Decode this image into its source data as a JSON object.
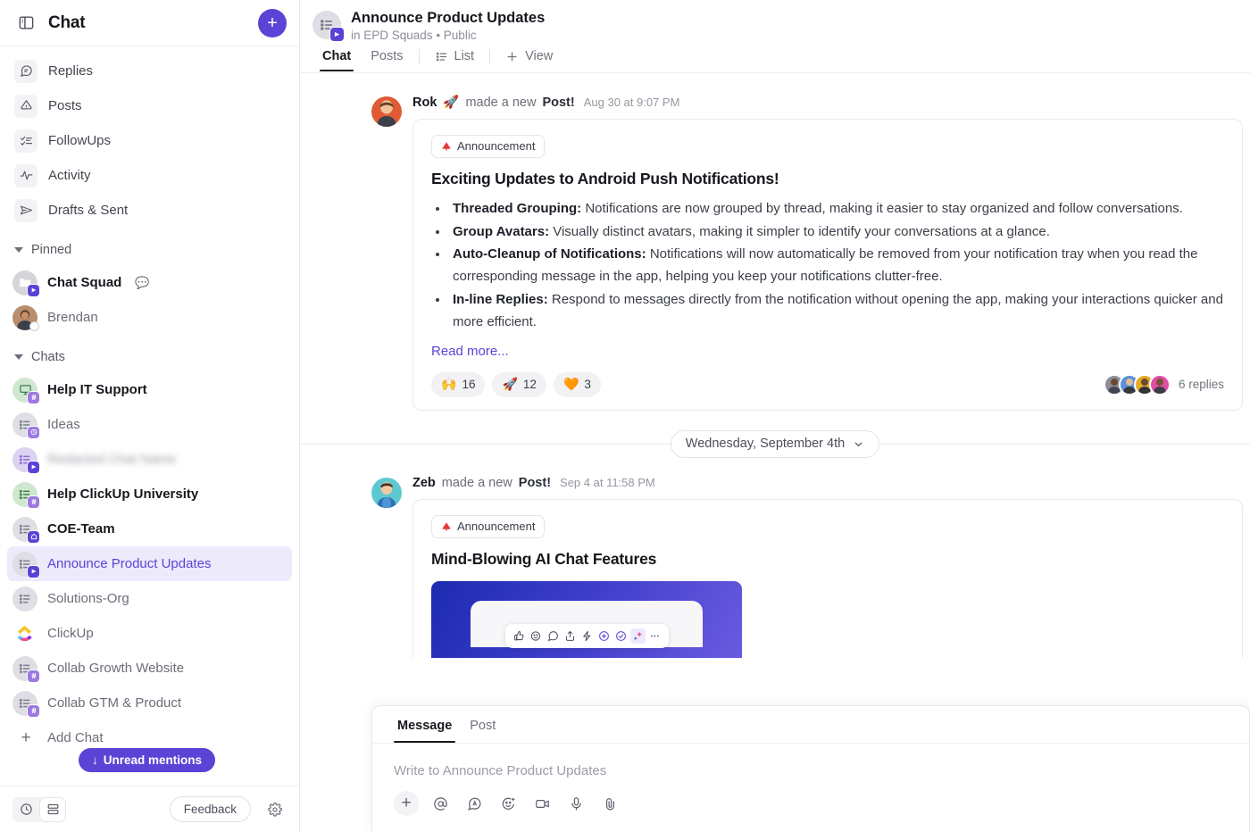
{
  "sidebar": {
    "panel_toggle_icon": "panel-toggle-icon",
    "title": "Chat",
    "new_button_label": "+",
    "nav": [
      {
        "label": "Replies",
        "icon": "comment-icon"
      },
      {
        "label": "Posts",
        "icon": "megaphone-icon"
      },
      {
        "label": "FollowUps",
        "icon": "checklist-icon"
      },
      {
        "label": "Activity",
        "icon": "activity-pulse-icon"
      },
      {
        "label": "Drafts & Sent",
        "icon": "send-plane-icon"
      }
    ],
    "sections": [
      {
        "label": "Pinned",
        "items": [
          {
            "label": "Chat Squad",
            "unread": true,
            "emoji": "💬",
            "avatar": "folder",
            "badge": "channel"
          },
          {
            "label": "Brendan",
            "unread": false,
            "avatar": "person",
            "badge": "status"
          }
        ]
      },
      {
        "label": "Chats",
        "items": [
          {
            "label": "Help IT Support",
            "unread": true,
            "avatar": "monitor-green",
            "badge": "hash"
          },
          {
            "label": "Ideas",
            "unread": false,
            "avatar": "list-gray",
            "badge": "clock"
          },
          {
            "label": "Redacted Chat Name",
            "unread": false,
            "blurred": true,
            "avatar": "list-violet",
            "badge": "channel"
          },
          {
            "label": "Help ClickUp University",
            "unread": true,
            "avatar": "list-green",
            "badge": "hash"
          },
          {
            "label": "COE-Team",
            "unread": true,
            "avatar": "list-gray",
            "badge": "home"
          },
          {
            "label": "Announce Product Updates",
            "unread": false,
            "active": true,
            "avatar": "list-gray",
            "badge": "channel"
          },
          {
            "label": "Solutions-Org",
            "unread": false,
            "avatar": "list-gray",
            "badge": "none"
          },
          {
            "label": "ClickUp",
            "unread": false,
            "avatar": "clickup-logo",
            "badge": "none"
          },
          {
            "label": "Collab Growth Website",
            "unread": false,
            "avatar": "list-gray",
            "badge": "hash"
          },
          {
            "label": "Collab GTM & Product",
            "unread": false,
            "avatar": "list-gray",
            "badge": "hash"
          }
        ]
      }
    ],
    "add_chat_label": "Add Chat",
    "unread_mentions_label": "Unread mentions",
    "unread_mentions_arrow": "↓",
    "footer": {
      "history_icon": "clock-history-icon",
      "layout_icon": "stacked-layout-icon",
      "feedback_label": "Feedback",
      "settings_icon": "gear-icon"
    }
  },
  "header": {
    "avatar_icon": "channel-list-icon",
    "title": "Announce Product Updates",
    "subtitle_prefix": "in ",
    "subtitle_space": "EPD Squads",
    "subtitle_sep": " • ",
    "subtitle_privacy": "Public",
    "tabs": [
      {
        "label": "Chat",
        "active": true
      },
      {
        "label": "Posts",
        "active": false
      },
      {
        "label": "List",
        "active": false,
        "icon": "list-icon"
      },
      {
        "label": "View",
        "active": false,
        "icon": "plus-icon"
      }
    ]
  },
  "feed": {
    "posts": [
      {
        "author": "Rok",
        "author_emoji": "🚀",
        "action": "made a new ",
        "action_bold": "Post!",
        "timestamp": "Aug 30 at 9:07 PM",
        "badge_label": "Announcement",
        "badge_icon": "megaphone-red-icon",
        "heading": "Exciting Updates to Android Push Notifications!",
        "bullets": [
          {
            "term": "Threaded Grouping:",
            "text": " Notifications are now grouped by thread, making it easier to stay organized and follow conversations."
          },
          {
            "term": "Group Avatars:",
            "text": " Visually distinct avatars, making it simpler to identify your conversations at a glance."
          },
          {
            "term": "Auto-Cleanup of Notifications:",
            "text": " Notifications will now automatically be removed from your notification tray when you read the corresponding message in the app, helping you keep your notifications clutter-free."
          },
          {
            "term": "In-line Replies:",
            "text": " Respond to messages directly from the notification without opening the app, making your interactions quicker and more efficient."
          }
        ],
        "read_more": "Read more...",
        "reactions": [
          {
            "emoji": "🙌",
            "count": "16"
          },
          {
            "emoji": "🚀",
            "count": "12"
          },
          {
            "emoji": "🧡",
            "count": "3"
          }
        ],
        "replies_label": "6 replies",
        "reply_avatars": [
          "#8d8f98",
          "#5b8fd8",
          "#e5ab24",
          "#e04ea8"
        ]
      },
      {
        "author": "Zeb",
        "action": "made a new ",
        "action_bold": "Post!",
        "timestamp": "Sep 4 at 11:58 PM",
        "badge_label": "Announcement",
        "badge_icon": "megaphone-red-icon",
        "heading": "Mind-Blowing AI Chat Features",
        "embed_toolbar_icons": [
          "thumbs-up-icon",
          "emoji-reaction-icon",
          "comment-icon",
          "share-upload-icon",
          "lightning-icon",
          "add-circle-icon",
          "resolve-check-icon",
          "ai-sparkle-icon",
          "more-dots-icon"
        ]
      }
    ],
    "date_divider": {
      "label": "Wednesday, September 4th",
      "chevron_icon": "chevron-down-icon"
    }
  },
  "composer": {
    "tabs": [
      {
        "label": "Message",
        "active": true
      },
      {
        "label": "Post",
        "active": false
      }
    ],
    "placeholder": "Write to Announce Product Updates",
    "tools": [
      {
        "icon": "plus-icon"
      },
      {
        "icon": "mention-at-icon"
      },
      {
        "icon": "ai-assist-icon"
      },
      {
        "icon": "emoji-icon"
      },
      {
        "icon": "video-camera-icon"
      },
      {
        "icon": "microphone-icon"
      },
      {
        "icon": "attachment-clip-icon"
      }
    ]
  },
  "colors": {
    "accent": "#5b43d6",
    "active_bg": "#eceafb",
    "text": "#16181d",
    "muted": "#6b6e78"
  }
}
